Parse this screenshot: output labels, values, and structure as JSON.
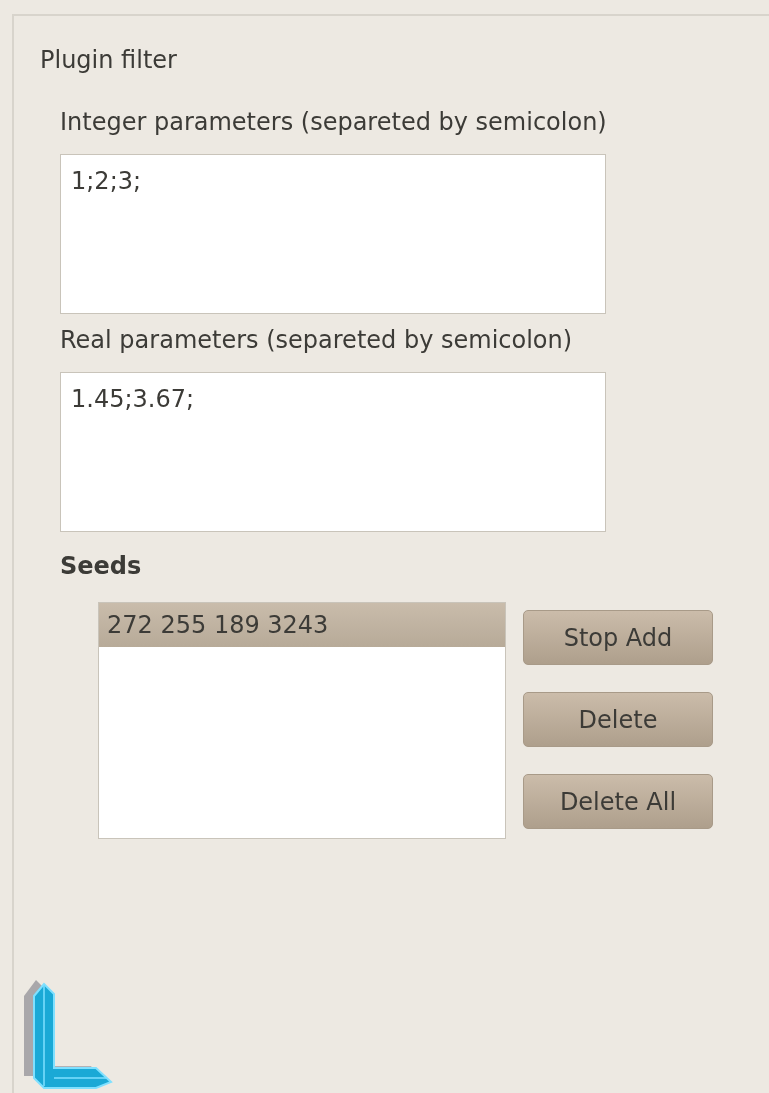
{
  "panel": {
    "title": "Plugin filter"
  },
  "integer_parameters": {
    "label": "Integer parameters (separeted by semicolon)",
    "value": "1;2;3;"
  },
  "real_parameters": {
    "label": "Real parameters (separeted by semicolon)",
    "value": "1.45;3.67;"
  },
  "seeds": {
    "label": "Seeds",
    "items": [
      {
        "text": "272 255 189 3243",
        "selected": true
      }
    ],
    "buttons": [
      "Stop Add",
      "Delete",
      "Delete All"
    ]
  }
}
